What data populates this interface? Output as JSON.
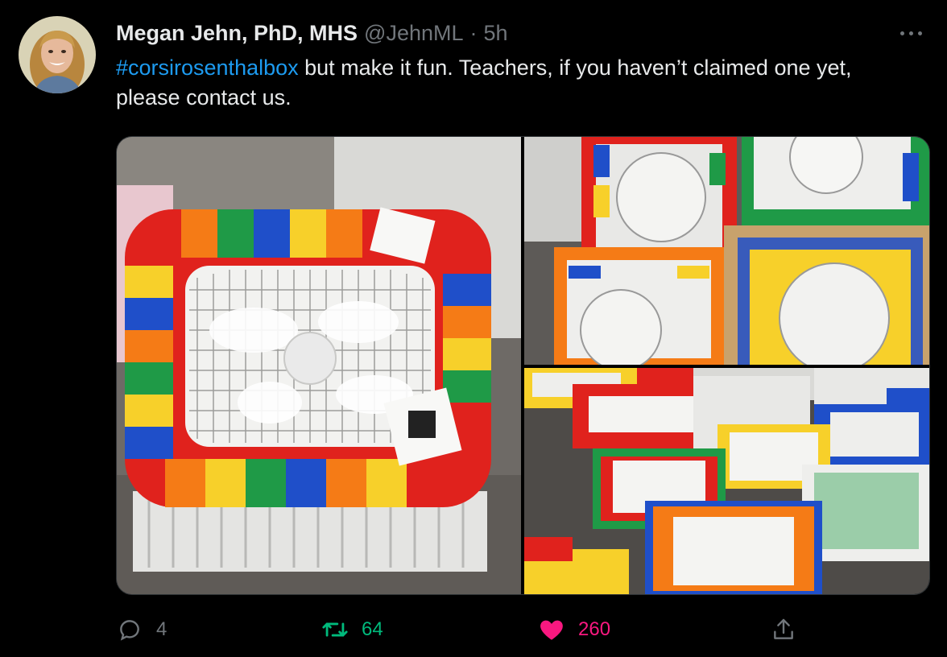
{
  "tweet": {
    "author_name": "Megan Jehn, PhD, MHS",
    "handle": "@JehnML",
    "separator": "·",
    "time": "5h",
    "hashtag": "#corsirosenthalbox",
    "text_after_hashtag": " but make it fun. Teachers, if you haven’t claimed one yet, please contact us."
  },
  "icons": {
    "more": "more-dots-icon",
    "reply": "reply-icon",
    "retweet": "retweet-icon",
    "like": "heart-icon",
    "share": "share-icon"
  },
  "actions": {
    "reply_count": "4",
    "retweet_count": "64",
    "like_count": "260"
  },
  "colors": {
    "background": "#000000",
    "text": "#e7e9ea",
    "muted": "#71767b",
    "link": "#1d9bf0",
    "retweet": "#00ba7c",
    "like": "#f91880"
  }
}
